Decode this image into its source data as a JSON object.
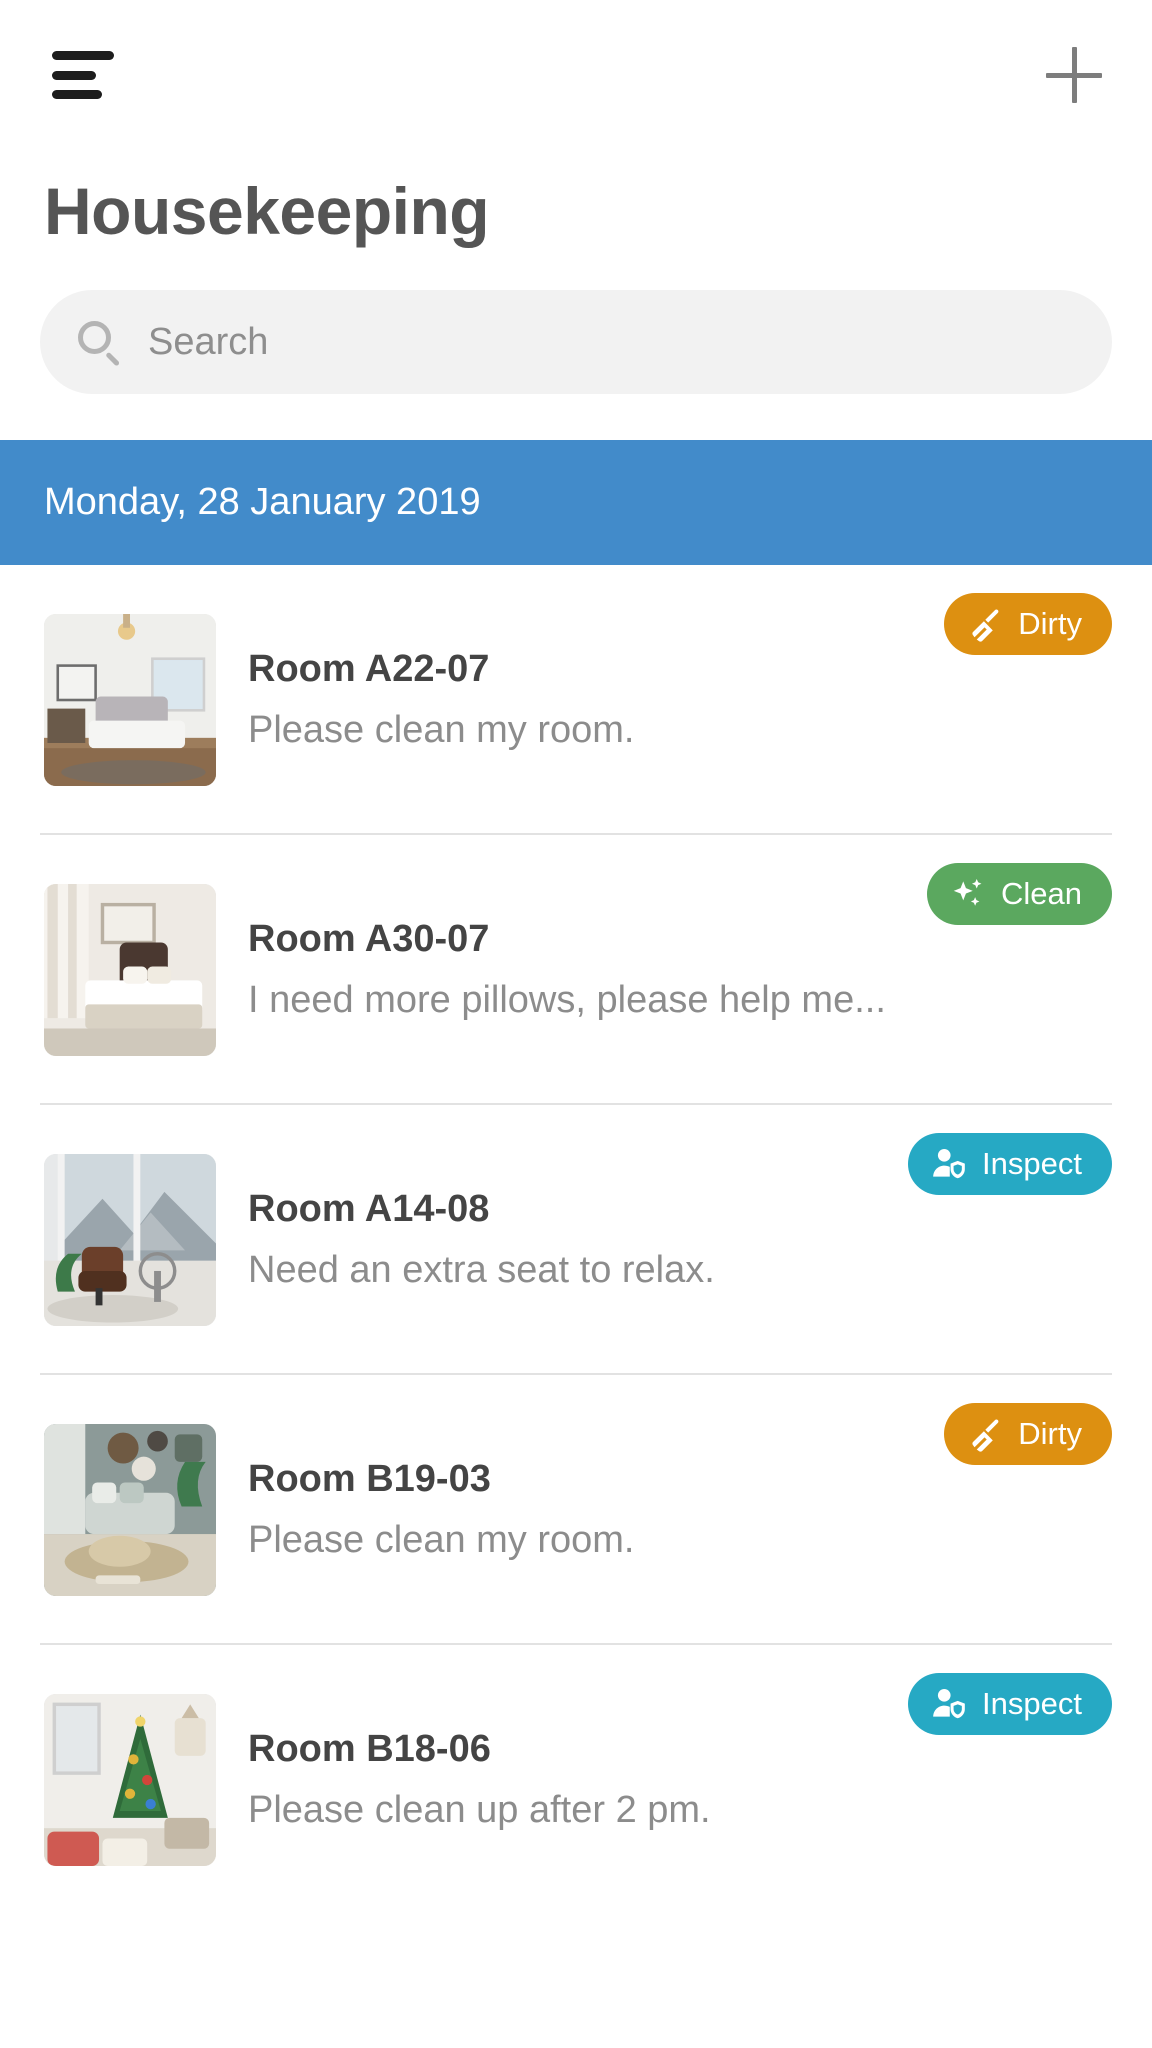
{
  "topbar": {
    "menu_icon": "hamburger-menu-icon",
    "add_icon": "plus-icon"
  },
  "header": {
    "title": "Housekeeping"
  },
  "search": {
    "icon": "search-icon",
    "value": "",
    "placeholder": "Search"
  },
  "date_banner": {
    "text": "Monday, 28 January 2019",
    "color": "#428bca"
  },
  "status_colors": {
    "dirty": "#dd9011",
    "clean": "#5ba85f",
    "inspect": "#26a9c4"
  },
  "rooms": [
    {
      "name": "Room A22-07",
      "message": "Please clean my room.",
      "status": "Dirty",
      "status_key": "dirty",
      "status_icon": "brush-icon",
      "thumb": "bedroom-grey-tufted-headboard"
    },
    {
      "name": "Room A30-07",
      "message": "I need more pillows, please help me...",
      "status": "Clean",
      "status_key": "clean",
      "status_icon": "sparkles-icon",
      "thumb": "bedroom-white-bed-curtains"
    },
    {
      "name": "Room A14-08",
      "message": "Need an extra seat to relax.",
      "status": "Inspect",
      "status_key": "inspect",
      "status_icon": "person-shield-icon",
      "thumb": "lounge-chair-mountain-window"
    },
    {
      "name": "Room B19-03",
      "message": "Please clean my room.",
      "status": "Dirty",
      "status_key": "dirty",
      "status_icon": "brush-icon",
      "thumb": "living-room-plants-rattan"
    },
    {
      "name": "Room B18-06",
      "message": "Please clean up after 2 pm.",
      "status": "Inspect",
      "status_key": "inspect",
      "status_icon": "person-shield-icon",
      "thumb": "living-room-christmas-tree"
    }
  ]
}
